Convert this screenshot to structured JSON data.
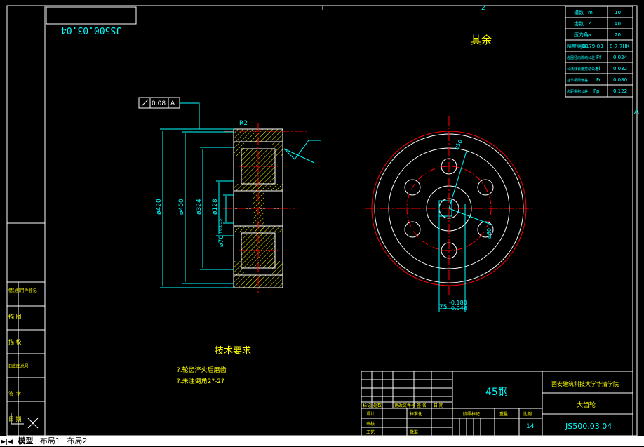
{
  "drawing": {
    "code_mirrored": "JS500.03.04",
    "code": "JS500.03.04",
    "remaining_roughness": "其余",
    "tech_req_title": "技术要求",
    "tech_req_items": [
      "?.轮齿淬火后磨齿",
      "?.未注倒角2?-2?"
    ],
    "material": "45钢",
    "school": "西安建筑科技大学华清学院",
    "part_name": "大齿轮",
    "sheet_count": "14",
    "zone_A": "A",
    "zone_2": "2"
  },
  "gear_params": [
    {
      "label": "模数",
      "sym": "m",
      "value": "10"
    },
    {
      "label": "齿数",
      "sym": "Z",
      "value": "40"
    },
    {
      "label": "压力角",
      "sym": "a",
      "value": "20"
    },
    {
      "label": "精度等级",
      "sym": "JB179-83",
      "value": "8-7-7HK"
    },
    {
      "label": "齿圈径向跳动公差",
      "sym": "Ff",
      "value": "0.024"
    },
    {
      "label": "公法线长度变动公差",
      "sym": "Fi",
      "value": "0.032"
    },
    {
      "label": "基节极限偏差",
      "sym": "Fr",
      "value": "0.080"
    },
    {
      "label": "齿距累积公差",
      "sym": "Fp",
      "value": "0.122"
    }
  ],
  "dims": {
    "d420": "ø420",
    "d400": "ø400",
    "d324": "ø324",
    "d128": "ø128",
    "d70": "ø70",
    "d70_tol": "+0.035",
    "r2": "R2",
    "d50": "ø50",
    "d60": "ø60",
    "key_w": "75",
    "key_tol_a": "-0.180",
    "key_tol_b": "-0.046",
    "tol_value": "0.08",
    "tol_datum": "A"
  },
  "left_strip": [
    "借(通)用件登记",
    "描 图",
    "描 校",
    "旧底图总号",
    "签 字",
    "日 期"
  ],
  "title_block": {
    "h_mark": "标记",
    "h_qty": "处数",
    "h_doc": "更改文件号",
    "h_sign": "签 名",
    "h_date": "日 期",
    "design": "设计",
    "std": "标准化",
    "review": "审核",
    "process": "工艺",
    "approve": "批准",
    "stage": "阶段标记",
    "weight": "重量",
    "ratio": "比例"
  },
  "tabs": {
    "nav": "▶|◀",
    "model": "模型",
    "layout1": "布局1",
    "layout2": "布局2"
  },
  "colors": {
    "bg": "#000000",
    "frame": "#ffffff",
    "cyan": "#00ffff",
    "red": "#ff0000",
    "yellow": "#ffff00"
  }
}
